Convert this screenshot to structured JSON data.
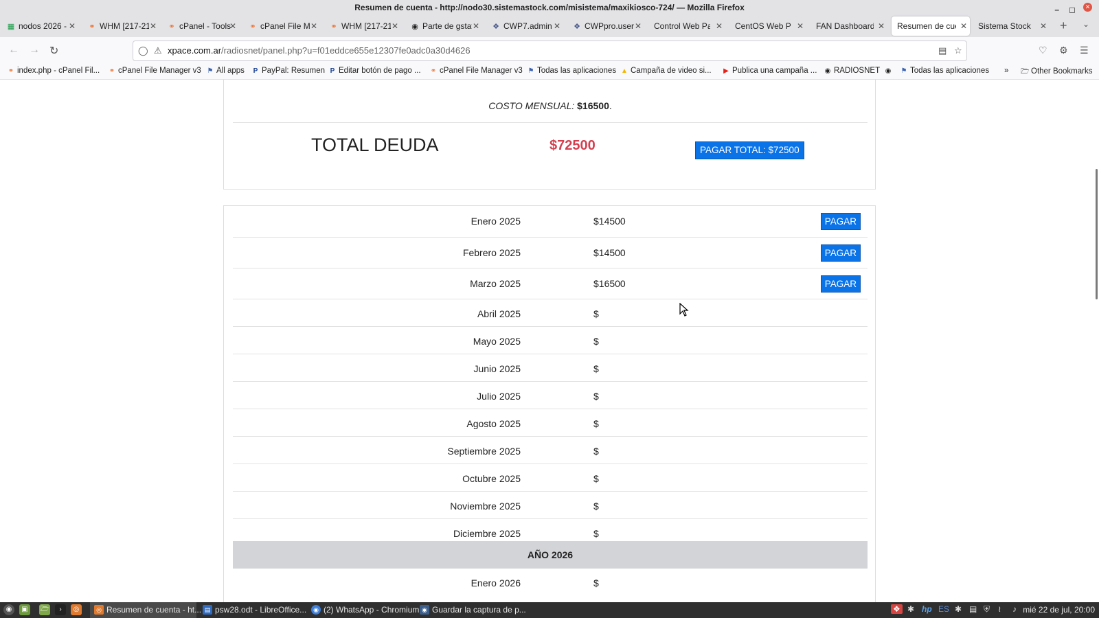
{
  "window": {
    "title": "Resumen de cuenta - http://nodo30.sistemastock.com/misistema/maxikiosco-724/ — Mozilla Firefox"
  },
  "tabs": [
    {
      "label": "nodos 2026 - ",
      "icon": "sheets-icon"
    },
    {
      "label": "WHM [217-21",
      "icon": "cpanel-icon"
    },
    {
      "label": "cPanel - Tools",
      "icon": "cpanel-icon"
    },
    {
      "label": "cPanel File M",
      "icon": "cpanel-icon"
    },
    {
      "label": "WHM [217-21",
      "icon": "cpanel-icon"
    },
    {
      "label": "Parte de gstat",
      "icon": "globe-icon"
    },
    {
      "label": "CWP7.admin |",
      "icon": "cwp-icon"
    },
    {
      "label": "CWPpro.user",
      "icon": "cwp-icon"
    },
    {
      "label": "Control Web Pan",
      "icon": ""
    },
    {
      "label": "CentOS Web Pan",
      "icon": ""
    },
    {
      "label": "FAN Dashboard",
      "icon": ""
    },
    {
      "label": "Resumen de cuen",
      "icon": ""
    },
    {
      "label": "Sistema Stock",
      "icon": ""
    }
  ],
  "url": {
    "domain": "xpace.com.ar",
    "path": "/radiosnet/panel.php?u=f01eddce655e12307fe0adc0a30d4626"
  },
  "bookmarks": [
    {
      "label": "index.php - cPanel Fil...",
      "icon": "cpanel-icon"
    },
    {
      "label": "cPanel File Manager v3",
      "icon": "cpanel-icon"
    },
    {
      "label": "All apps",
      "icon": "flag-icon"
    },
    {
      "label": "PayPal: Resumen",
      "icon": "paypal-icon"
    },
    {
      "label": "Editar botón de pago ...",
      "icon": "paypal-icon"
    },
    {
      "label": "cPanel File Manager v3",
      "icon": "cpanel-icon"
    },
    {
      "label": "Todas las aplicaciones",
      "icon": "flag-icon"
    },
    {
      "label": "Campaña de video si...",
      "icon": "ads-icon"
    },
    {
      "label": "Publica una campaña ...",
      "icon": "youtube-icon"
    },
    {
      "label": "RADIOSNET",
      "icon": "globe-icon"
    },
    {
      "label": "",
      "icon": "globe-icon"
    },
    {
      "label": "Todas las aplicaciones",
      "icon": "flag-icon"
    }
  ],
  "bookmarks_other": "Other Bookmarks",
  "summary": {
    "costo_label": "COSTO MENSUAL:",
    "costo_value": "$16500",
    "costo_end": ".",
    "total_label": "TOTAL DEUDA",
    "total_value": "$72500",
    "pay_total_button": "PAGAR TOTAL: $72500"
  },
  "colors": {
    "accent": "#0a73e8",
    "debt": "#d43f4f"
  },
  "months": [
    {
      "mes": "Enero 2025",
      "monto": "$14500",
      "pagar": "PAGAR"
    },
    {
      "mes": "Febrero 2025",
      "monto": "$14500",
      "pagar": "PAGAR"
    },
    {
      "mes": "Marzo 2025",
      "monto": "$16500",
      "pagar": "PAGAR"
    },
    {
      "mes": "Abril 2025",
      "monto": "$"
    },
    {
      "mes": "Mayo 2025",
      "monto": "$"
    },
    {
      "mes": "Junio 2025",
      "monto": "$"
    },
    {
      "mes": "Julio 2025",
      "monto": "$"
    },
    {
      "mes": "Agosto 2025",
      "monto": "$"
    },
    {
      "mes": "Septiembre 2025",
      "monto": "$"
    },
    {
      "mes": "Octubre 2025",
      "monto": "$"
    },
    {
      "mes": "Noviembre 2025",
      "monto": "$"
    },
    {
      "mes": "Diciembre 2025",
      "monto": "$"
    }
  ],
  "year_header": "AÑO 2026",
  "months_2026": [
    {
      "mes": "Enero 2026",
      "monto": "$"
    }
  ],
  "taskbar": {
    "items": [
      {
        "label": "Resumen de cuenta - ht...",
        "icon": "firefox-icon"
      },
      {
        "label": "psw28.odt - LibreOffice...",
        "icon": "writer-icon"
      },
      {
        "label": "(2) WhatsApp - Chromium",
        "icon": "chromium-icon"
      },
      {
        "label": "Guardar la captura de p...",
        "icon": "camera-icon"
      }
    ],
    "lang": "ES",
    "clock": "mié 22 de jul, 20:00"
  }
}
